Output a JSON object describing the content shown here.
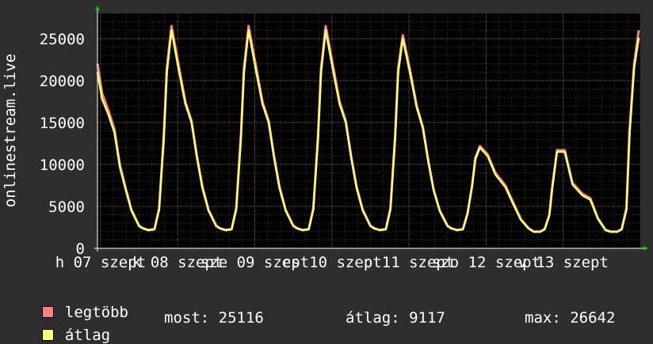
{
  "chart_data": {
    "type": "area",
    "ylabel": "onlinestream.live",
    "ylim": [
      0,
      28000
    ],
    "y_ticks": [
      "0",
      "5000",
      "10000",
      "15000",
      "20000",
      "25000"
    ],
    "x_range_days": [
      6.96,
      14.0
    ],
    "x_ticks": [
      {
        "label": "h 07 szept",
        "day": 7
      },
      {
        "label": "k 08 szept",
        "day": 8
      },
      {
        "label": "sze 09 szept",
        "day": 9
      },
      {
        "label": "cs 10 szept",
        "day": 10
      },
      {
        "label": "p 11 szept",
        "day": 11
      },
      {
        "label": "szo 12 szept",
        "day": 12
      },
      {
        "label": "v 13 szept",
        "day": 13
      }
    ],
    "grid": true,
    "legend_position": "bottom-left",
    "colors": {
      "max": "#ff8080",
      "avg": "#ffff80",
      "grid": "#5a5a5a",
      "axis": "#ffffff",
      "arrow": "#00cc00"
    },
    "x": [
      6.96,
      7.02,
      7.1,
      7.18,
      7.25,
      7.32,
      7.4,
      7.5,
      7.55,
      7.62,
      7.7,
      7.76,
      7.82,
      7.86,
      7.92,
      8.02,
      8.1,
      8.18,
      8.25,
      8.32,
      8.4,
      8.5,
      8.55,
      8.62,
      8.7,
      8.76,
      8.82,
      8.86,
      8.92,
      9.02,
      9.1,
      9.18,
      9.25,
      9.32,
      9.4,
      9.5,
      9.55,
      9.62,
      9.7,
      9.76,
      9.82,
      9.86,
      9.92,
      10.02,
      10.1,
      10.18,
      10.25,
      10.32,
      10.4,
      10.5,
      10.55,
      10.62,
      10.7,
      10.76,
      10.82,
      10.86,
      10.92,
      11.02,
      11.1,
      11.18,
      11.25,
      11.32,
      11.4,
      11.5,
      11.55,
      11.62,
      11.7,
      11.76,
      11.82,
      11.86,
      11.92,
      12.02,
      12.12,
      12.25,
      12.35,
      12.45,
      12.55,
      12.62,
      12.7,
      12.76,
      12.82,
      12.86,
      12.92,
      13.02,
      13.12,
      13.25,
      13.35,
      13.45,
      13.55,
      13.62,
      13.7,
      13.76,
      13.82,
      13.86,
      13.92,
      13.98
    ],
    "series": [
      {
        "name": "legtöbb",
        "values": [
          22000,
          18500,
          16500,
          14200,
          10000,
          7400,
          4600,
          2700,
          2400,
          2200,
          2300,
          4800,
          13500,
          21500,
          26500,
          21500,
          17500,
          15200,
          11000,
          7400,
          4600,
          2700,
          2400,
          2200,
          2300,
          4800,
          13500,
          21500,
          26500,
          21500,
          17500,
          15200,
          11000,
          7400,
          4600,
          2700,
          2400,
          2200,
          2300,
          4800,
          13500,
          21500,
          26500,
          21500,
          17500,
          15200,
          11000,
          7400,
          4600,
          2700,
          2400,
          2200,
          2300,
          4800,
          13500,
          21500,
          25400,
          21000,
          17000,
          14500,
          10500,
          7000,
          4500,
          2700,
          2400,
          2200,
          2300,
          4200,
          7600,
          10800,
          12200,
          11200,
          9000,
          7500,
          5500,
          3500,
          2400,
          2000,
          2000,
          2300,
          4000,
          7500,
          11700,
          11700,
          7800,
          6500,
          6000,
          3600,
          2200,
          2000,
          2000,
          2300,
          4800,
          14000,
          22000,
          26000
        ]
      },
      {
        "name": "átlag",
        "values": [
          21000,
          17800,
          16000,
          13800,
          9700,
          7200,
          4500,
          2650,
          2350,
          2150,
          2250,
          4600,
          13000,
          21000,
          26000,
          21000,
          17200,
          15000,
          10800,
          7200,
          4500,
          2650,
          2350,
          2150,
          2250,
          4600,
          13000,
          21000,
          26000,
          21000,
          17200,
          15000,
          10800,
          7200,
          4500,
          2650,
          2350,
          2150,
          2250,
          4600,
          13000,
          21000,
          26000,
          21000,
          17200,
          15000,
          10800,
          7200,
          4500,
          2650,
          2350,
          2150,
          2250,
          4600,
          13000,
          21000,
          25000,
          20600,
          16800,
          14300,
          10300,
          6900,
          4400,
          2650,
          2350,
          2150,
          2250,
          4100,
          7500,
          10600,
          12000,
          11000,
          8800,
          7300,
          5300,
          3400,
          2350,
          1950,
          1950,
          2250,
          3900,
          7300,
          11500,
          11500,
          7600,
          6300,
          5800,
          3500,
          2150,
          1950,
          1950,
          2250,
          4600,
          13500,
          21500,
          25116
        ]
      }
    ]
  },
  "legend": {
    "items": [
      {
        "label": "legtöbb",
        "color": "#ff8080"
      },
      {
        "label": "átlag",
        "color": "#ffff80"
      }
    ],
    "stats": {
      "most": "most: 25116",
      "atlag": "átlag: 9117",
      "max": "max: 26642"
    }
  }
}
